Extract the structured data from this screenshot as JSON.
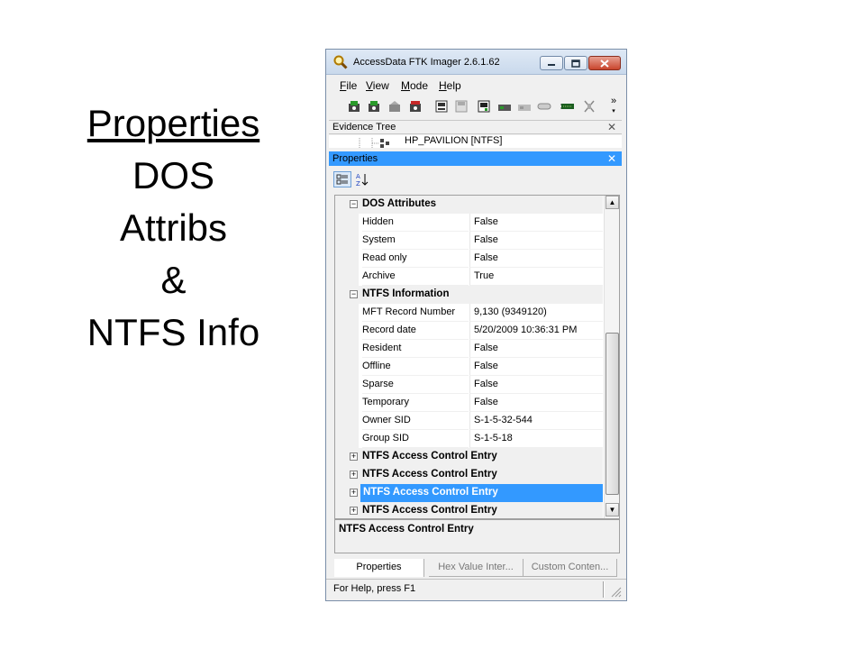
{
  "slide": {
    "title_line1": "Properties",
    "title_line2": "DOS",
    "title_line3": "Attribs",
    "title_line4": "&",
    "title_line5": "NTFS Info"
  },
  "window": {
    "title": "AccessData FTK Imager 2.6.1.62",
    "menu": [
      {
        "label": "File",
        "accel": "F",
        "rest": "ile"
      },
      {
        "label": "View",
        "accel": "V",
        "rest": "iew"
      },
      {
        "label": "Mode",
        "accel": "M",
        "rest": "ode"
      },
      {
        "label": "Help",
        "accel": "H",
        "rest": "elp"
      }
    ],
    "overflow_chevron": "»"
  },
  "evidence_tree": {
    "header": "Evidence Tree",
    "visible_node": "HP_PAVILION [NTFS]"
  },
  "properties": {
    "header": "Properties",
    "categories": [
      {
        "name": "DOS Attributes",
        "expanded": true,
        "rows": [
          {
            "name": "Hidden",
            "value": "False"
          },
          {
            "name": "System",
            "value": "False"
          },
          {
            "name": "Read only",
            "value": "False"
          },
          {
            "name": "Archive",
            "value": "True"
          }
        ]
      },
      {
        "name": "NTFS Information",
        "expanded": true,
        "rows": [
          {
            "name": "MFT Record Number",
            "value": "9,130 (9349120)"
          },
          {
            "name": "Record date",
            "value": "5/20/2009 10:36:31 PM"
          },
          {
            "name": "Resident",
            "value": "False"
          },
          {
            "name": "Offline",
            "value": "False"
          },
          {
            "name": "Sparse",
            "value": "False"
          },
          {
            "name": "Temporary",
            "value": "False"
          },
          {
            "name": "Owner SID",
            "value": "S-1-5-32-544"
          },
          {
            "name": "Group SID",
            "value": "S-1-5-18"
          }
        ]
      },
      {
        "name": "NTFS Access Control Entry",
        "expanded": false
      },
      {
        "name": "NTFS Access Control Entry",
        "expanded": false
      },
      {
        "name": "NTFS Access Control Entry",
        "expanded": false,
        "selected": true
      },
      {
        "name": "NTFS Access Control Entry",
        "expanded": false
      }
    ],
    "description_title": "NTFS Access Control Entry"
  },
  "tabs": [
    {
      "label": "Properties",
      "active": true
    },
    {
      "label": "Hex Value Inter...",
      "active": false
    },
    {
      "label": "Custom Conten...",
      "active": false
    }
  ],
  "status": {
    "text": "For Help, press F1"
  },
  "colors": {
    "selection": "#3399ff",
    "titlebar": "#c9d9ec"
  }
}
